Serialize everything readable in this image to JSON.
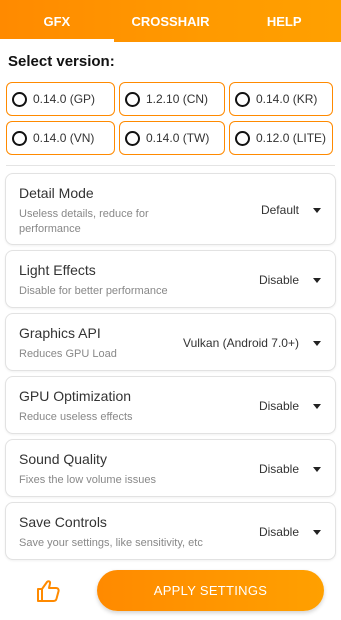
{
  "tabs": [
    {
      "label": "GFX"
    },
    {
      "label": "CROSSHAIR"
    },
    {
      "label": "HELP"
    }
  ],
  "version": {
    "title": "Select version:",
    "options": [
      {
        "label": "0.14.0 (GP)"
      },
      {
        "label": "1.2.10 (CN)"
      },
      {
        "label": "0.14.0 (KR)"
      },
      {
        "label": "0.14.0 (VN)"
      },
      {
        "label": "0.14.0 (TW)"
      },
      {
        "label": "0.12.0 (LITE)"
      }
    ]
  },
  "settings": [
    {
      "title": "Detail Mode",
      "subtitle": "Useless details, reduce for performance",
      "value": "Default"
    },
    {
      "title": "Light Effects",
      "subtitle": "Disable for better performance",
      "value": "Disable"
    },
    {
      "title": "Graphics API",
      "subtitle": "Reduces GPU Load",
      "value": "Vulkan (Android 7.0+)"
    },
    {
      "title": "GPU Optimization",
      "subtitle": "Reduce useless effects",
      "value": "Disable"
    },
    {
      "title": "Sound Quality",
      "subtitle": "Fixes the low volume issues",
      "value": "Disable"
    },
    {
      "title": "Save Controls",
      "subtitle": "Save your settings, like sensitivity, etc",
      "value": "Disable"
    }
  ],
  "footer": {
    "apply_label": "APPLY SETTINGS",
    "like_icon": "thumbs-up-icon"
  },
  "colors": {
    "accent": "#ff9000",
    "accent_light": "#ffa000"
  }
}
